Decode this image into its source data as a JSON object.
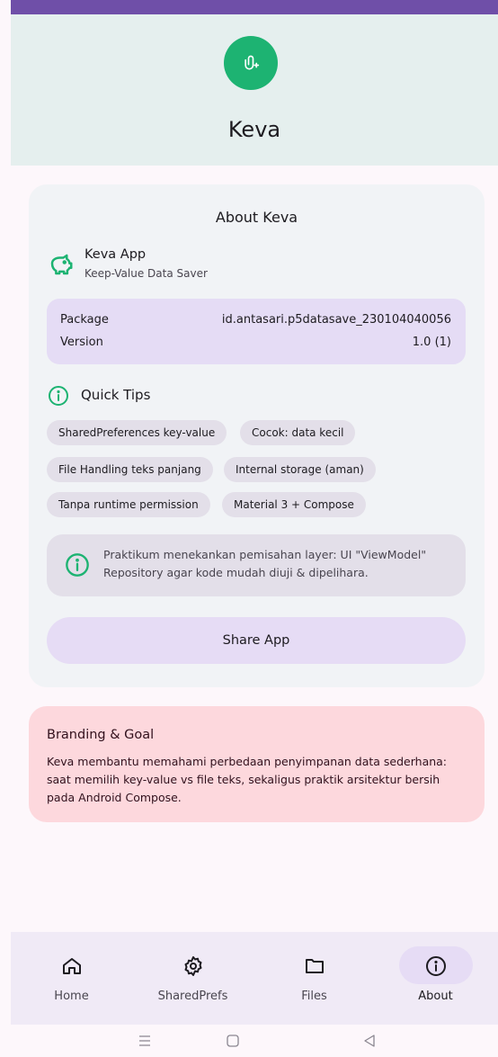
{
  "header": {
    "app_name": "Keva"
  },
  "about": {
    "title": "About Keva",
    "app_title": "Keva App",
    "app_subtitle": "Keep-Value Data Saver",
    "package_label": "Package",
    "package_value": "id.antasari.p5datasave_230104040056",
    "version_label": "Version",
    "version_value": "1.0 (1)",
    "tips_title": "Quick Tips",
    "chips": [
      "SharedPreferences key-value",
      "Cocok: data kecil",
      "File Handling teks panjang",
      "Internal storage (aman)",
      "Tanpa runtime permission",
      "Material 3 + Compose"
    ],
    "note": "Praktikum menekankan pemisahan layer: UI \"ViewModel\" Repository agar kode mudah diuji & dipelihara.",
    "share_label": "Share App"
  },
  "goal": {
    "title": "Branding & Goal",
    "text": "Keva membantu memahami perbedaan penyimpanan data sederhana: saat memilih key-value vs file teks, sekaligus praktik arsitektur bersih pada Android Compose."
  },
  "bottom_nav": {
    "items": [
      {
        "label": "Home",
        "icon": "home-icon"
      },
      {
        "label": "SharedPrefs",
        "icon": "gear-icon"
      },
      {
        "label": "Files",
        "icon": "folder-icon"
      },
      {
        "label": "About",
        "icon": "info-icon",
        "active": true
      }
    ]
  },
  "colors": {
    "accent": "#1db372",
    "status_bar": "#6f4fa8",
    "header_bg": "#e5efee",
    "goal_card": "#fdd8dd",
    "nav_active": "#e6dcf5"
  }
}
